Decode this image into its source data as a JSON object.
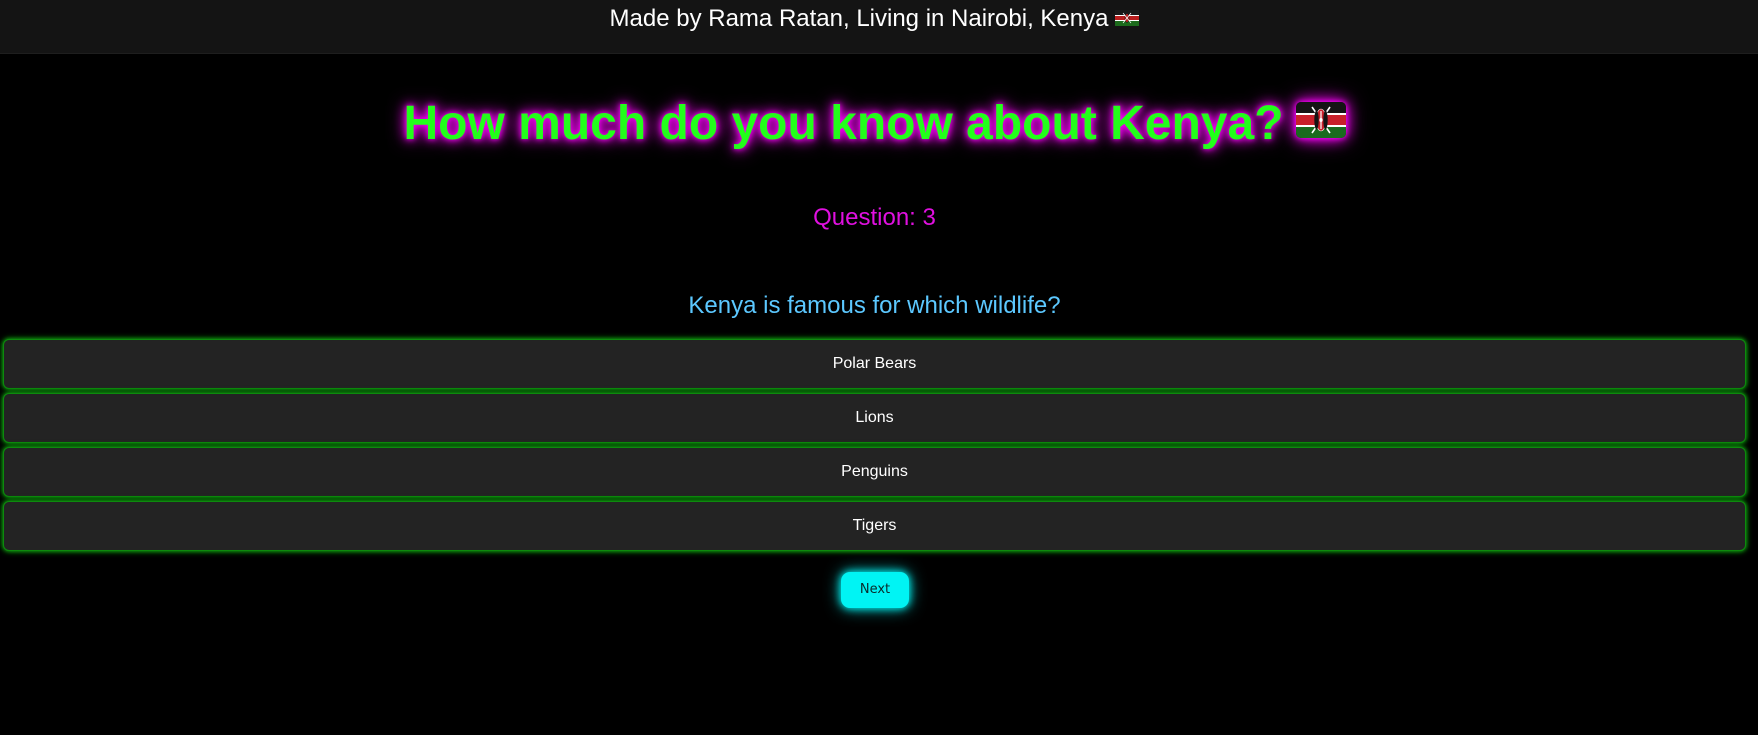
{
  "header": {
    "credit_text": "Made by Rama Ratan, Living in Nairobi, Kenya",
    "credit_flag_icon": "kenya-flag-icon"
  },
  "quiz": {
    "title": "How much do you know about Kenya?",
    "title_flag_icon": "kenya-flag-icon",
    "question_number": "Question: 3",
    "question_text": "Kenya is famous for which wildlife?",
    "options": [
      {
        "label": "Polar Bears"
      },
      {
        "label": "Lions"
      },
      {
        "label": "Penguins"
      },
      {
        "label": "Tigers"
      }
    ],
    "next_label": "Next"
  },
  "colors": {
    "background": "#000000",
    "top_bar": "#141414",
    "title": "#22ff1a",
    "title_glow": "#ff00ff",
    "question_number": "#e010e0",
    "question_text": "#5cc8ff",
    "option_background": "#232323",
    "option_border": "#0d8a0d",
    "next_button": "#00f4f4"
  }
}
